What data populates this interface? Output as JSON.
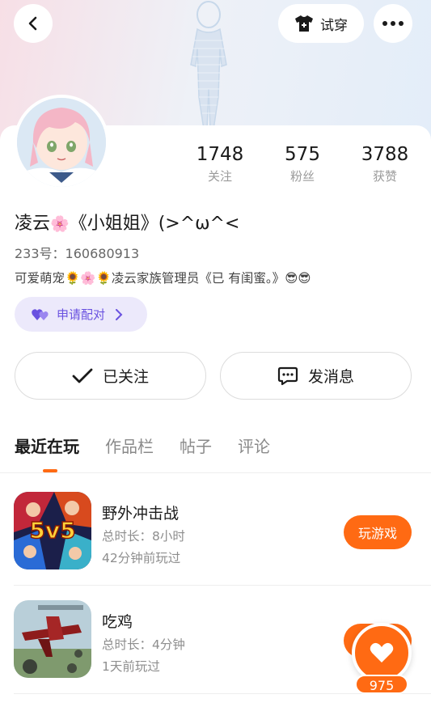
{
  "header": {
    "tryon_label": "试穿",
    "back_icon": "back-arrow-icon",
    "more_icon": "more-dots-icon",
    "tshirt_icon": "tshirt-icon"
  },
  "stats": [
    {
      "value": "1748",
      "label": "关注"
    },
    {
      "value": "575",
      "label": "粉丝"
    },
    {
      "value": "3788",
      "label": "获赞"
    }
  ],
  "profile": {
    "name_part1": "凌云",
    "name_part2": "《小姐姐》(>^ω^<",
    "uid": "233号：160680913",
    "bio": "可爱萌宠🌻🌸🌻凌云家族管理员《已 有闺蜜。》😎😎",
    "pair_label": "申请配对"
  },
  "actions": {
    "follow_label": "已关注",
    "message_label": "发消息"
  },
  "tabs": [
    {
      "label": "最近在玩",
      "active": true
    },
    {
      "label": "作品栏",
      "active": false
    },
    {
      "label": "帖子",
      "active": false
    },
    {
      "label": "评论",
      "active": false
    }
  ],
  "games": [
    {
      "name": "野外冲击战",
      "duration": "总时长：8小时",
      "last_played": "42分钟前玩过",
      "button": "玩游戏",
      "badge": "5v5"
    },
    {
      "name": "吃鸡",
      "duration": "总时长：4分钟",
      "last_played": "1天前玩过",
      "button": "玩游戏"
    }
  ],
  "like_fab": {
    "count": "975",
    "icon": "heart-icon"
  },
  "colors": {
    "accent": "#ff6a13",
    "pair_bg": "#ece9fb",
    "pair_fg": "#6a52e0"
  }
}
